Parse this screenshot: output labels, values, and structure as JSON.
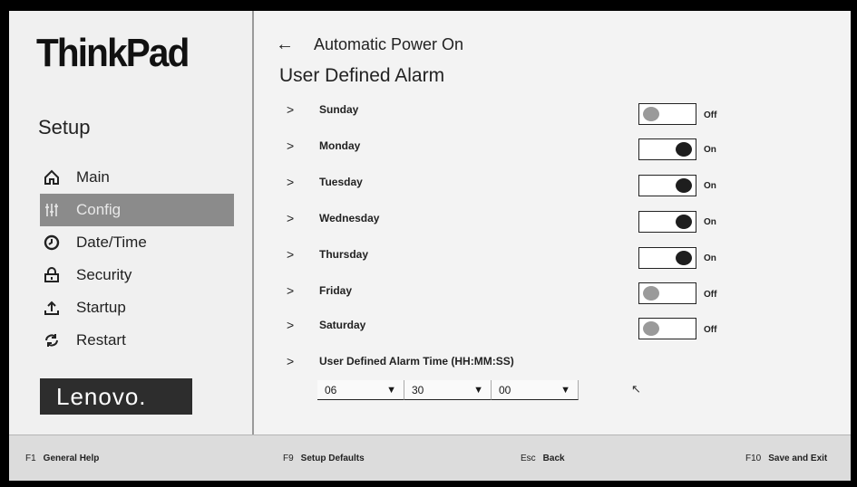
{
  "brand": {
    "logo_text": "ThinkPad",
    "vendor": "Lenovo."
  },
  "sidebar": {
    "title": "Setup",
    "items": [
      {
        "label": "Main",
        "icon": "home-icon"
      },
      {
        "label": "Config",
        "icon": "sliders-icon",
        "active": true
      },
      {
        "label": "Date/Time",
        "icon": "clock-icon"
      },
      {
        "label": "Security",
        "icon": "lock-icon"
      },
      {
        "label": "Startup",
        "icon": "upload-icon"
      },
      {
        "label": "Restart",
        "icon": "refresh-icon"
      }
    ]
  },
  "header": {
    "breadcrumb": "Automatic Power On",
    "back_icon": "back-arrow-icon",
    "title": "User Defined Alarm"
  },
  "days": [
    {
      "label": "Sunday",
      "state": "Off"
    },
    {
      "label": "Monday",
      "state": "On"
    },
    {
      "label": "Tuesday",
      "state": "On"
    },
    {
      "label": "Wednesday",
      "state": "On"
    },
    {
      "label": "Thursday",
      "state": "On"
    },
    {
      "label": "Friday",
      "state": "Off"
    },
    {
      "label": "Saturday",
      "state": "Off"
    }
  ],
  "alarm_time": {
    "label": "User Defined Alarm Time (HH:MM:SS)",
    "hours": "06",
    "minutes": "30",
    "seconds": "00"
  },
  "footer": {
    "help": {
      "key": "F1",
      "label": "General Help"
    },
    "defaults": {
      "key": "F9",
      "label": "Setup Defaults"
    },
    "back": {
      "key": "Esc",
      "label": "Back"
    },
    "save": {
      "key": "F10",
      "label": "Save and Exit"
    }
  },
  "colors": {
    "active_nav": "#8b8b8b",
    "toggle_on": "#1e1e1e",
    "toggle_off": "#9a9a9a"
  }
}
